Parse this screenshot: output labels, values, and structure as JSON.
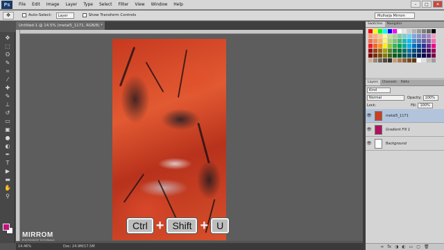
{
  "app": {
    "logo": "Ps"
  },
  "menu": [
    "File",
    "Edit",
    "Image",
    "Layer",
    "Type",
    "Select",
    "Filter",
    "View",
    "Window",
    "Help"
  ],
  "window_controls": [
    "–",
    "□",
    "✕"
  ],
  "options": {
    "tool_icon": "move-tool",
    "auto_select_label": "Auto-Select:",
    "auto_select_value": "Layer",
    "show_transform_label": "Show Transform Controls",
    "workspace": "Mulhaija Mirrom"
  },
  "document": {
    "tab_title": "Untitled-1 @ 14.5% (metal5_1171, RGB/8) *",
    "close": "×"
  },
  "toolbar": {
    "tools": [
      "move",
      "marquee",
      "lasso",
      "quick-select",
      "crop",
      "eyedropper",
      "healing",
      "brush",
      "clone-stamp",
      "history-brush",
      "eraser",
      "gradient",
      "blur",
      "dodge",
      "pen",
      "type",
      "path-select",
      "shape",
      "hand",
      "zoom"
    ],
    "glyphs": [
      "✥",
      "⬚",
      "ʘ",
      "✎",
      "⌗",
      "⁄",
      "✚",
      "✎",
      "⊥",
      "↺",
      "▭",
      "▣",
      "●",
      "◐",
      "✒",
      "T",
      "▶",
      "▬",
      "✋",
      "⚲"
    ],
    "fg_color": "#c2127e",
    "bg_color": "#ffffff"
  },
  "shortcut": {
    "keys": [
      "Ctrl",
      "Shift",
      "U"
    ],
    "plus": "+"
  },
  "logo": {
    "title": "MIRROM",
    "subtitle": "PHOTOSHOP TUTORIALS"
  },
  "status": {
    "zoom": "14.46%",
    "doc": "Doc: 24.9M/17.5M"
  },
  "panels": {
    "top_tabs": [
      "Swatches",
      "Navigator"
    ],
    "swatch_colors": [
      "#ff0000",
      "#ffff00",
      "#00ff00",
      "#00ffff",
      "#0000ff",
      "#ff00ff",
      "#ffffff",
      "#e6e6e6",
      "#cccccc",
      "#b3b3b3",
      "#999999",
      "#808080",
      "#666666",
      "#000000",
      "#f7977a",
      "#f9ad81",
      "#fdc68a",
      "#fff79a",
      "#c4df9b",
      "#a2d39c",
      "#82ca9d",
      "#7bcdc8",
      "#6ecff6",
      "#7ea7d8",
      "#8493ca",
      "#8882be",
      "#a187be",
      "#f49ac2",
      "#f26c4f",
      "#f68e55",
      "#fbaf5c",
      "#fff467",
      "#acd372",
      "#7cc576",
      "#3bb878",
      "#1abbb4",
      "#00bff3",
      "#438ccb",
      "#5574b9",
      "#605ca8",
      "#855fa8",
      "#f06ea9",
      "#ed1c24",
      "#f26522",
      "#f7941d",
      "#fff200",
      "#8dc73f",
      "#39b54a",
      "#00a651",
      "#00a99d",
      "#00aeef",
      "#0072bc",
      "#0054a6",
      "#2e3192",
      "#662d91",
      "#ec008c",
      "#9e0b0f",
      "#a0410d",
      "#a36209",
      "#aba000",
      "#598527",
      "#1a7b30",
      "#007236",
      "#00746b",
      "#0076a3",
      "#004b80",
      "#003471",
      "#1b1464",
      "#440e62",
      "#9e005d",
      "#790000",
      "#7b2e00",
      "#7d4900",
      "#827b00",
      "#406618",
      "#005e20",
      "#005826",
      "#005952",
      "#005b7f",
      "#003663",
      "#002157",
      "#0d004c",
      "#32004b",
      "#7b0046",
      "#c7b299",
      "#998675",
      "#736357",
      "#534741",
      "#37302d",
      "#c69c6d",
      "#a67c52",
      "#8c6239",
      "#754c24",
      "#603913",
      "#ffffff",
      "#e0e0e0",
      "#bdbdbd",
      "#9e9e9e"
    ],
    "layer_tabs": [
      "Layers",
      "Channels",
      "Paths"
    ],
    "kind": "Kind",
    "blend_mode": "Normal",
    "opacity_label": "Opacity:",
    "opacity": "100%",
    "lock_label": "Lock:",
    "fill_label": "Fill:",
    "fill": "100%",
    "layers": [
      {
        "name": "metal5_1171",
        "selected": true,
        "thumb": "#c8401f",
        "eye": "👁"
      },
      {
        "name": "Gradient Fill 1",
        "selected": false,
        "thumb": "#b0105e",
        "eye": "👁"
      },
      {
        "name": "Background",
        "selected": false,
        "thumb": "#ffffff",
        "eye": "👁"
      }
    ],
    "footer_glyphs": [
      "∞",
      "fx",
      "◑",
      "◐",
      "▭",
      "▢",
      "🗑"
    ]
  }
}
